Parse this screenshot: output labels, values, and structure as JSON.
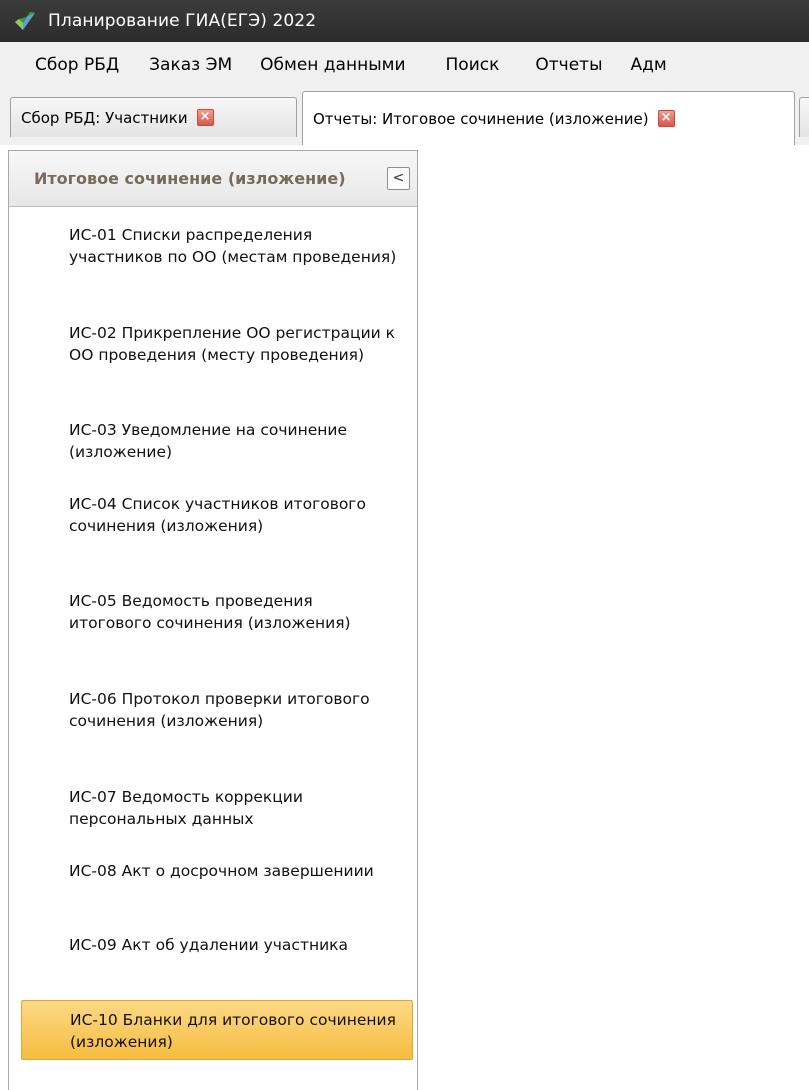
{
  "window": {
    "title": "Планирование ГИА(ЕГЭ) 2022",
    "icon": "app-logo-icon"
  },
  "menu": {
    "items": [
      "Сбор РБД",
      "Заказ ЭМ",
      "Обмен данными",
      "Поиск",
      "Отчеты",
      "Адм"
    ]
  },
  "tabs": [
    {
      "label": "Сбор РБД: Участники",
      "active": false
    },
    {
      "label": "Отчеты: Итоговое сочинение (изложение)",
      "active": true
    },
    {
      "label": "",
      "active": false
    }
  ],
  "panel": {
    "title": "Итоговое сочинение (изложение)",
    "collapse_label": "<",
    "items": [
      {
        "label": "ИС-01 Списки распределения участников по ОО (местам проведения)",
        "selected": false
      },
      {
        "label": "ИС-02 Прикрепление ОО регистрации к ОО проведения (месту проведения)",
        "selected": false
      },
      {
        "label": "ИС-03 Уведомление на сочинение (изложение)",
        "selected": false
      },
      {
        "label": "ИС-04 Список участников итогового сочинения (изложения)",
        "selected": false
      },
      {
        "label": "ИС-05 Ведомость проведения итогового сочинения (изложения)",
        "selected": false
      },
      {
        "label": "ИС-06 Протокол проверки итогового сочинения (изложения)",
        "selected": false
      },
      {
        "label": "ИС-07 Ведомость коррекции персональных данных",
        "selected": false
      },
      {
        "label": "ИС-08 Акт о досрочном завершениии",
        "selected": false
      },
      {
        "label": "ИС-09 Акт об удалении участника",
        "selected": false
      },
      {
        "label": "ИС-10 Бланки для итогового сочинения (изложения)",
        "selected": true
      }
    ]
  },
  "colors": {
    "titlebar": "#2f2f2f",
    "selected_item": "#f6bc40",
    "panel_title": "#7a6a5a",
    "tab_close": "#d9574a"
  }
}
